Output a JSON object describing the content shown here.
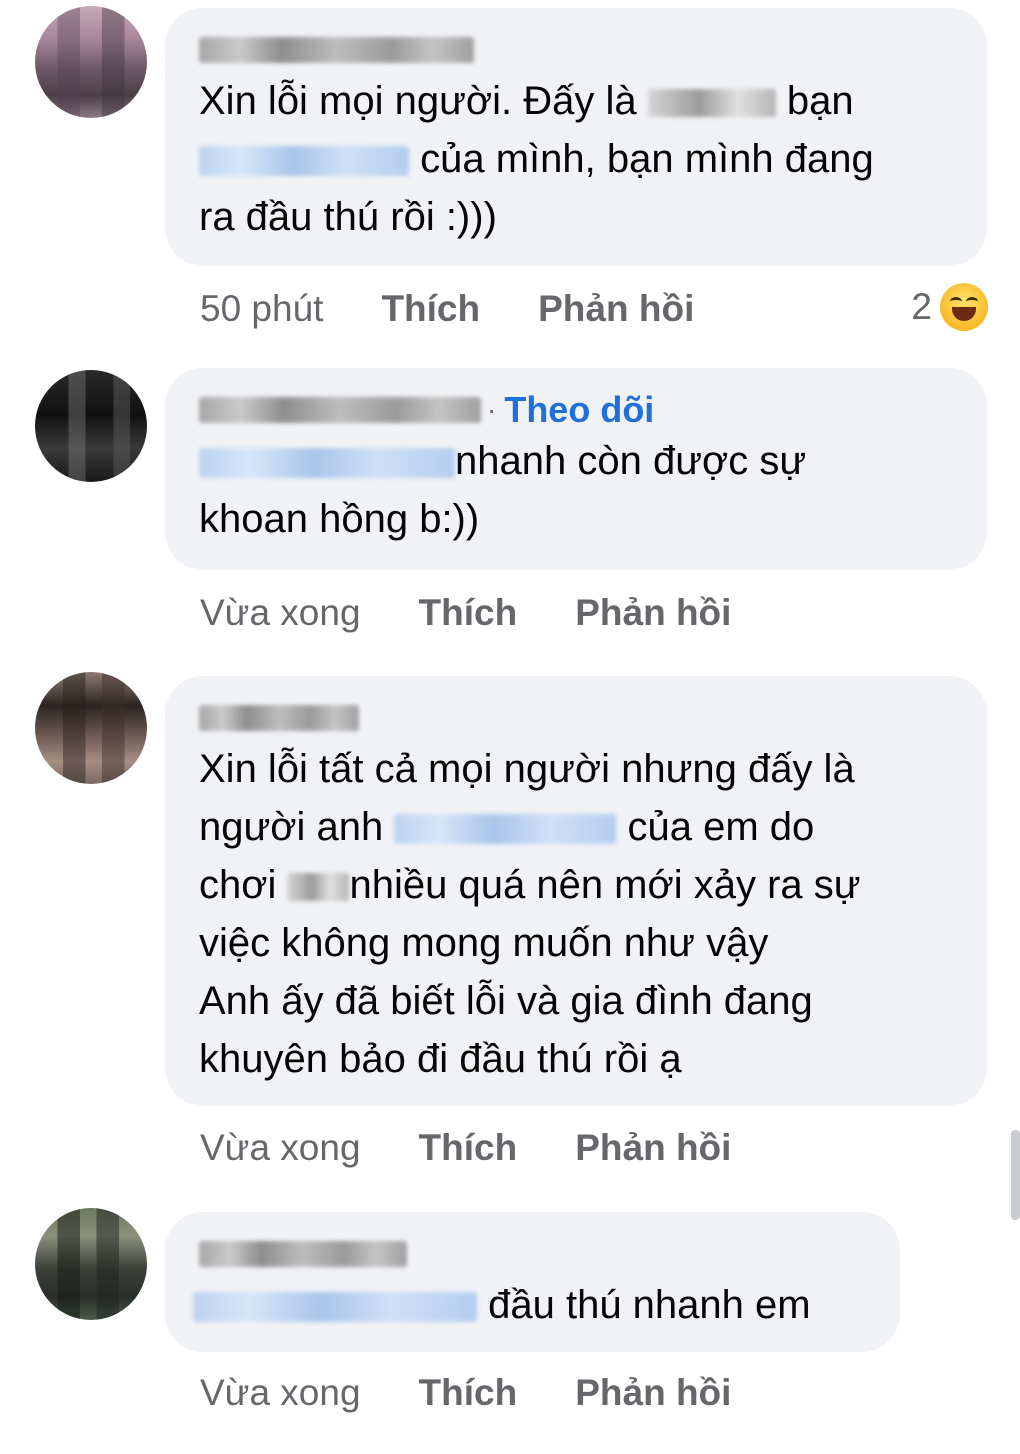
{
  "comments": [
    {
      "avatar_colors": [
        "#b89aa6",
        "#6a5b6e",
        "#8b7a83"
      ],
      "follow_label": "",
      "lines": [
        {
          "before": "Xin lỗi mọi người. Đấy là ",
          "after": " bạn"
        },
        {
          "before": "",
          "after": " của mình, bạn mình đang"
        },
        {
          "before": "ra đầu thú rồi :)))",
          "after": ""
        }
      ],
      "time": "50 phút",
      "like": "Thích",
      "reply": "Phản hồi",
      "reaction_count": "2",
      "reaction_icon": "haha-reaction-icon"
    },
    {
      "avatar_colors": [
        "#1a1a1a",
        "#5a5a5a",
        "#333333"
      ],
      "follow_label": "Theo dõi",
      "lines": [
        {
          "before": "",
          "after": "nhanh còn được sự"
        },
        {
          "before": "khoan hồng b:))",
          "after": ""
        }
      ],
      "time": "Vừa xong",
      "like": "Thích",
      "reply": "Phản hồi"
    },
    {
      "avatar_colors": [
        "#7a6a63",
        "#3e3431",
        "#a58d82"
      ],
      "follow_label": "",
      "lines": [
        {
          "before": "Xin lỗi tất cả mọi người nhưng đấy là",
          "after": ""
        },
        {
          "before": "người anh ",
          "after": " của em do"
        },
        {
          "before": "chơi ",
          "after": "nhiều quá nên mới xảy ra sự"
        },
        {
          "before": "việc không mong muốn như vậy",
          "after": ""
        },
        {
          "before": "Anh ấy đã biết lỗi và gia đình đang",
          "after": ""
        },
        {
          "before": "khuyên bảo đi đầu thú rồi ạ",
          "after": ""
        }
      ],
      "time": "Vừa xong",
      "like": "Thích",
      "reply": "Phản hồi"
    },
    {
      "avatar_colors": [
        "#4d5b4a",
        "#2a2f2a",
        "#8a8f7a"
      ],
      "follow_label": "",
      "lines": [
        {
          "before": "",
          "after": " đầu thú nhanh em"
        }
      ],
      "time": "Vừa xong",
      "like": "Thích",
      "reply": "Phản hồi"
    }
  ]
}
